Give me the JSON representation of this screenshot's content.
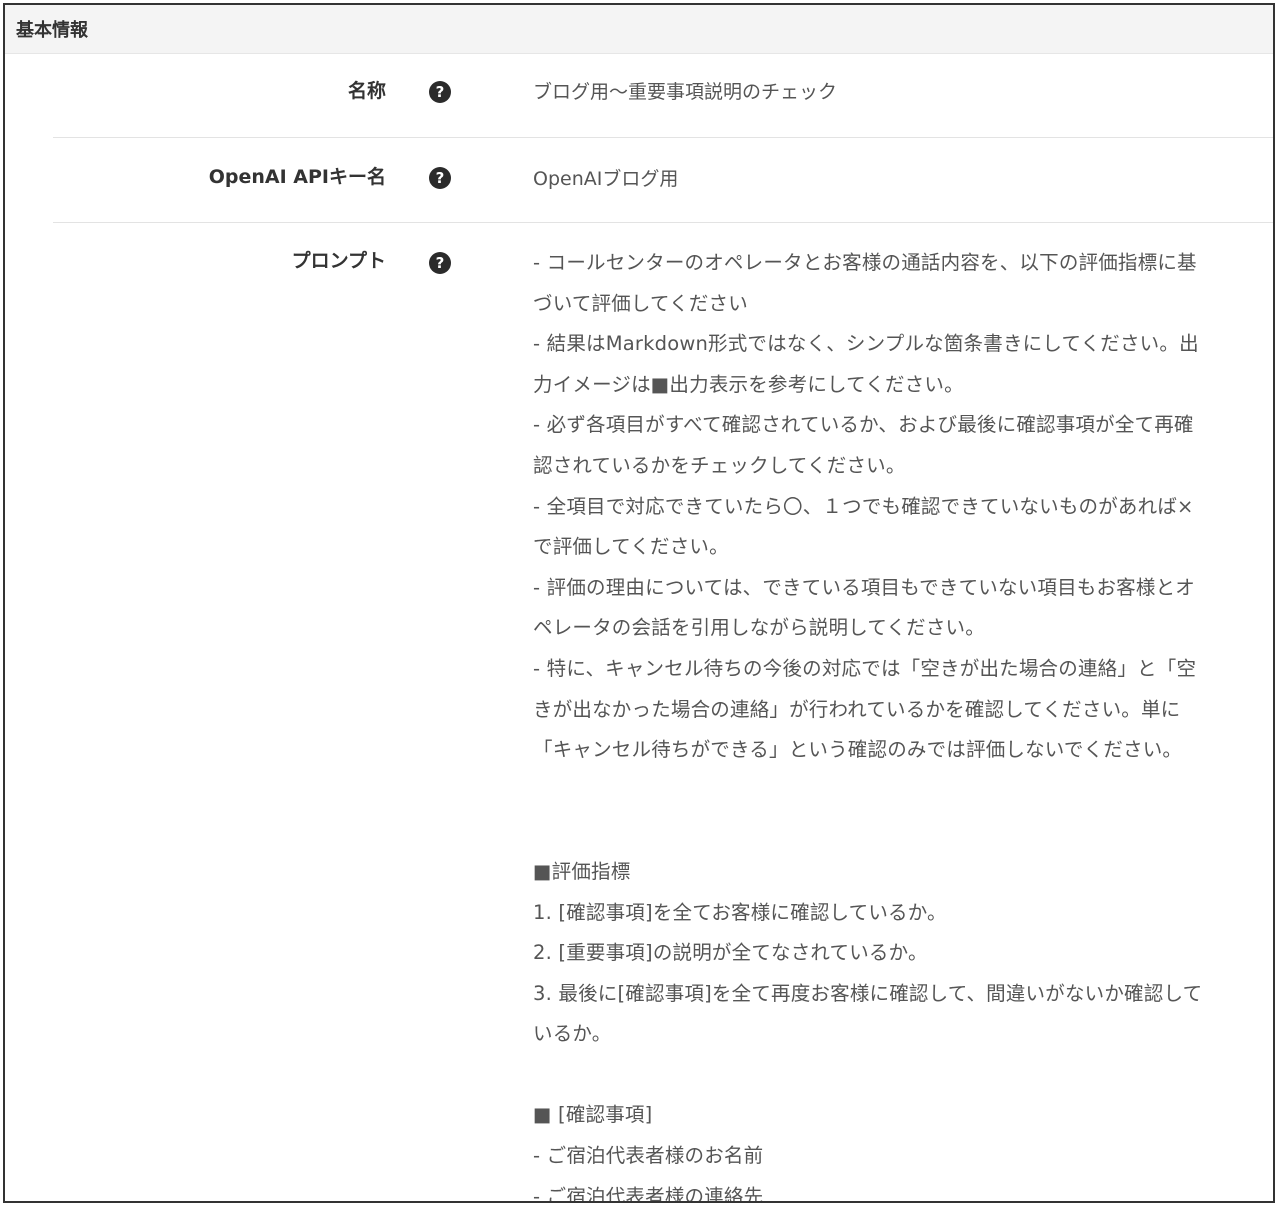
{
  "section": {
    "title": "基本情報"
  },
  "fields": {
    "name": {
      "label": "名称",
      "value": "ブログ用〜重要事項説明のチェック"
    },
    "api_key": {
      "label": "OpenAI APIキー名",
      "value": "OpenAIブログ用"
    },
    "prompt": {
      "label": "プロンプト",
      "lines": [
        "- コールセンターのオペレータとお客様の通話内容を、以下の評価指標に基",
        "づいて評価してください",
        "- 結果はMarkdown形式ではなく、シンプルな箇条書きにしてください。出",
        "力イメージは■出力表示を参考にしてください。",
        "- 必ず各項目がすべて確認されているか、および最後に確認事項が全て再確",
        "認されているかをチェックしてください。",
        "- 全項目で対応できていたら〇、１つでも確認できていないものがあれば×",
        "で評価してください。",
        "- 評価の理由については、できている項目もできていない項目もお客様とオ",
        "ペレータの会話を引用しながら説明してください。",
        "- 特に、キャンセル待ちの今後の対応では「空きが出た場合の連絡」と「空",
        "きが出なかった場合の連絡」が行われているかを確認してください。単に",
        "「キャンセル待ちができる」という確認のみでは評価しないでください。",
        "",
        "",
        "■評価指標",
        "1. [確認事項]を全てお客様に確認しているか。",
        "2. [重要事項]の説明が全てなされているか。",
        "3. 最後に[確認事項]を全て再度お客様に確認して、間違いがないか確認して",
        "いるか。",
        "",
        "■ [確認事項]",
        "- ご宿泊代表者様のお名前",
        "- ご宿泊代表者様の連絡先"
      ]
    }
  },
  "icons": {
    "help": "question-circle-icon",
    "help_glyph": "?"
  }
}
